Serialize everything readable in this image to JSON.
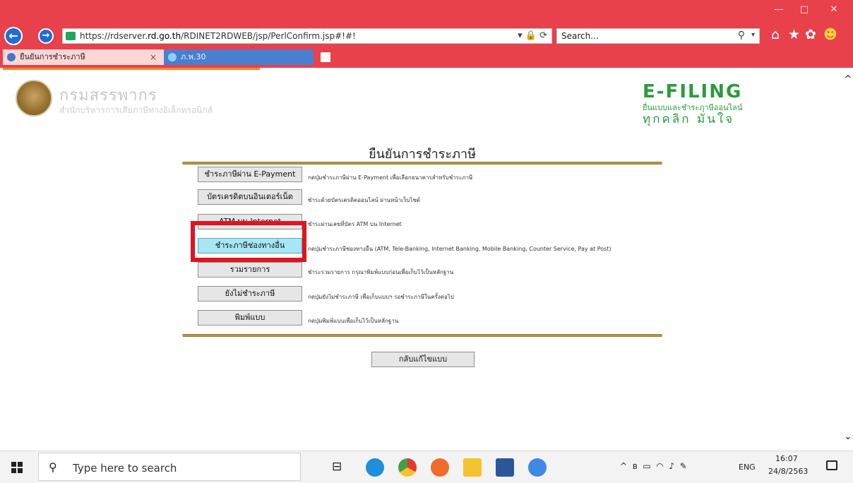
{
  "browser": {
    "url_prefix": "https://rdserver.",
    "url_domain": "rd.go.th",
    "url_path": "/RDINET2RDWEB/jsp/PerlConfirm.jsp#!#!",
    "search_placeholder": "Search...",
    "tabs": [
      {
        "title": "ยืนยันการชำระภาษี",
        "close": "×"
      },
      {
        "title": "ภ.พ.30"
      }
    ],
    "window_controls": {
      "minimize": "—",
      "maximize": "□",
      "close": "✕"
    }
  },
  "header": {
    "rd_name": "กรมสรรพากร",
    "rd_subtitle": "สำนักบริหารการเสียภาษีทางอิเล็กทรอนิกส์",
    "efiling_title": "E-FILING",
    "efiling_subtitle": "ยื่นแบบและชำระภาษีออนไลน์",
    "efiling_tagline": "ทุกคลิก มั่นใจ"
  },
  "page": {
    "title": "ยืนยันการชำระภาษี",
    "payment_options": [
      {
        "label": "ชำระภาษีผ่าน E-Payment",
        "desc": "กดปุ่มชำระภาษีผ่าน E-Payment เพื่อเลือกธนาคารสำหรับชำระภาษี"
      },
      {
        "label": "บัตรเครดิตบนอินเตอร์เน็ต",
        "desc": "ชำระด้วยบัตรเครดิตออนไลน์ ผ่านหน้าเว็บไซต์"
      },
      {
        "label": "ATM บน Internet",
        "desc": "ชำระผ่านเลขที่บัตร ATM บน Internet"
      },
      {
        "label": "ชำระภาษีช่องทางอื่น",
        "desc": "กดปุ่มชำระภาษีช่องทางอื่น (ATM, Tele-Banking, Internet Banking, Mobile Banking, Counter Service, Pay at Post)"
      },
      {
        "label": "รวมรายการ",
        "desc": "ชำระรวมรายการ กรุณาพิมพ์แบบก่อนเพื่อเก็บไว้เป็นหลักฐาน"
      },
      {
        "label": "ยังไม่ชำระภาษี",
        "desc": "กดปุ่มยังไม่ชำระภาษี เพื่อเก็บแบบฯ รอชำระภาษีในครั้งต่อไป"
      },
      {
        "label": "พิมพ์แบบ",
        "desc": "กดปุ่มพิมพ์แบบเพื่อเก็บไว้เป็นหลักฐาน"
      }
    ],
    "back_button": "กลับแก้ไขแบบ"
  },
  "taskbar": {
    "search_placeholder": "Type here to search",
    "language": "ENG",
    "time": "16:07",
    "date": "24/8/2563"
  },
  "colors": {
    "browser_chrome": "#e8414b",
    "efiling_green": "#2b9a3e",
    "highlight_box": "#e0141e",
    "active_button": "#a7e6f5",
    "gold_rule": "#c9a55a"
  }
}
